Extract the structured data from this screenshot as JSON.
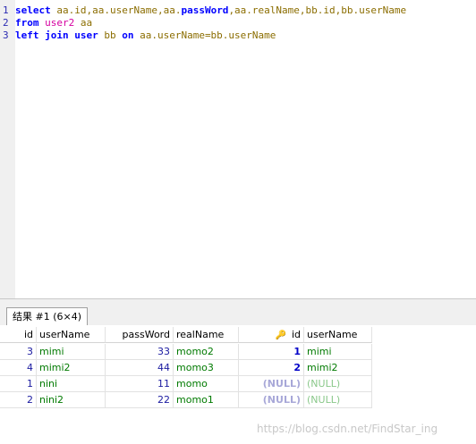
{
  "editor": {
    "lines": [
      {
        "num": "1",
        "parts": [
          {
            "t": "select",
            "k": "kw"
          },
          {
            "t": " aa.id,aa.userName,aa.",
            "k": "obj"
          },
          {
            "t": "passWord",
            "k": "kw"
          },
          {
            "t": ",aa.realName,bb.id,bb.userName",
            "k": "obj"
          }
        ]
      },
      {
        "num": "2",
        "parts": [
          {
            "t": "from",
            "k": "kw"
          },
          {
            "t": " ",
            "k": "txt"
          },
          {
            "t": "user2",
            "k": "tbl"
          },
          {
            "t": " aa",
            "k": "al"
          }
        ]
      },
      {
        "num": "3",
        "parts": [
          {
            "t": "left join user",
            "k": "kw"
          },
          {
            "t": " bb ",
            "k": "al"
          },
          {
            "t": "on",
            "k": "kw"
          },
          {
            "t": " aa.userName=bb.userName",
            "k": "obj"
          }
        ]
      }
    ]
  },
  "tab": {
    "label": "结果 #1 (6×4)"
  },
  "grid": {
    "columns": [
      "id",
      "userName",
      "passWord",
      "realName",
      "id",
      "userName"
    ],
    "key_icon": "key-icon",
    "rows": [
      [
        "3",
        "mimi",
        "33",
        "momo2",
        "1",
        "mimi"
      ],
      [
        "4",
        "mimi2",
        "44",
        "momo3",
        "2",
        "mimi2"
      ],
      [
        "1",
        "nini",
        "11",
        "momo",
        "(NULL)",
        "(NULL)"
      ],
      [
        "2",
        "nini2",
        "22",
        "momo1",
        "(NULL)",
        "(NULL)"
      ]
    ]
  },
  "watermark": "https://blog.csdn.net/FindStar_ing",
  "colors": {
    "keyword": "#0000ff",
    "table": "#d500a0",
    "identifier": "#8b6d00",
    "number": "#1a1aa0",
    "string": "#007a00"
  }
}
